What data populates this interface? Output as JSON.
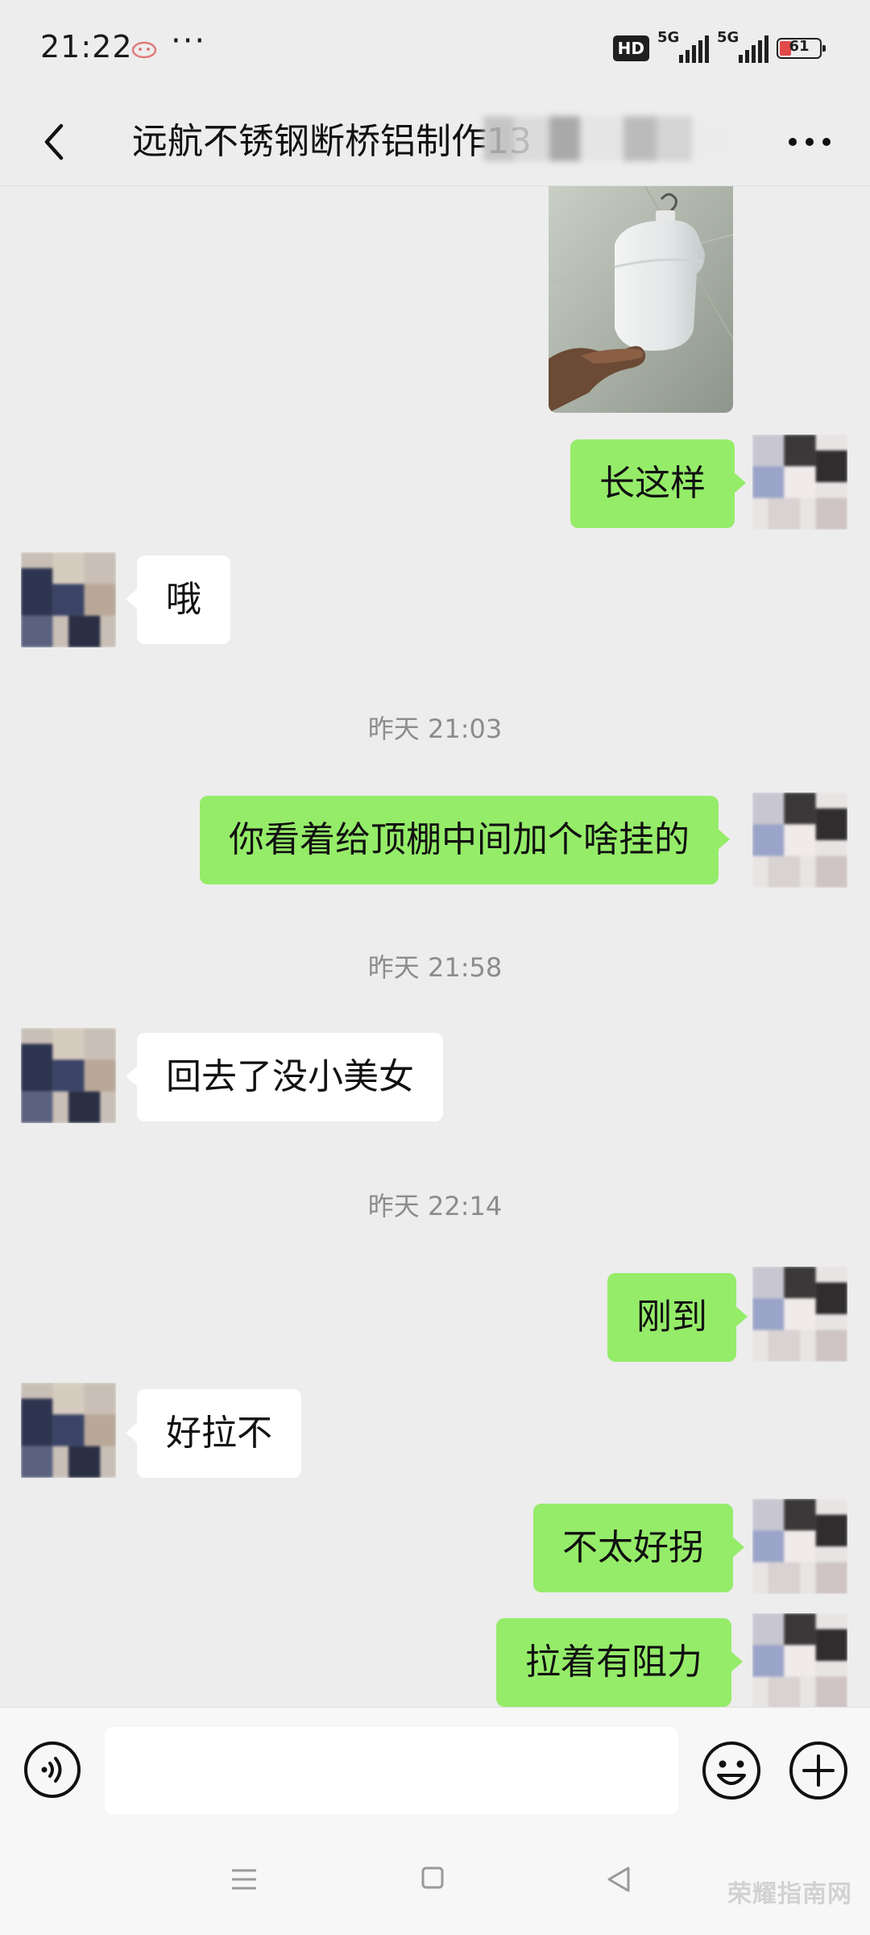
{
  "status_bar": {
    "time": "21:22",
    "more": "···",
    "hd": "HD",
    "network_1": "5G",
    "network_2": "5G",
    "battery": "61"
  },
  "nav": {
    "title": "远航不锈钢断桥铝制作13"
  },
  "messages": [
    {
      "type": "image",
      "direction": "out",
      "description_icon": "photo-lamp"
    },
    {
      "type": "text",
      "direction": "out",
      "text": "长这样"
    },
    {
      "type": "text",
      "direction": "in",
      "text": "哦"
    },
    {
      "type": "time",
      "text": "昨天 21:03"
    },
    {
      "type": "text",
      "direction": "out",
      "text": "你看着给顶棚中间加个啥挂的"
    },
    {
      "type": "time",
      "text": "昨天 21:58"
    },
    {
      "type": "text",
      "direction": "in",
      "text": "回去了没小美女"
    },
    {
      "type": "time",
      "text": "昨天 22:14"
    },
    {
      "type": "text",
      "direction": "out",
      "text": "刚到"
    },
    {
      "type": "text",
      "direction": "in",
      "text": "好拉不"
    },
    {
      "type": "text",
      "direction": "out",
      "text": "不太好拐"
    },
    {
      "type": "text",
      "direction": "out",
      "text": "拉着有阻力"
    }
  ],
  "input": {
    "placeholder": ""
  },
  "watermark": "荣耀指南网",
  "colors": {
    "background": "#ededed",
    "outgoing_bubble": "#95ec69",
    "incoming_bubble": "#ffffff",
    "time_text": "#8c8c8c"
  }
}
